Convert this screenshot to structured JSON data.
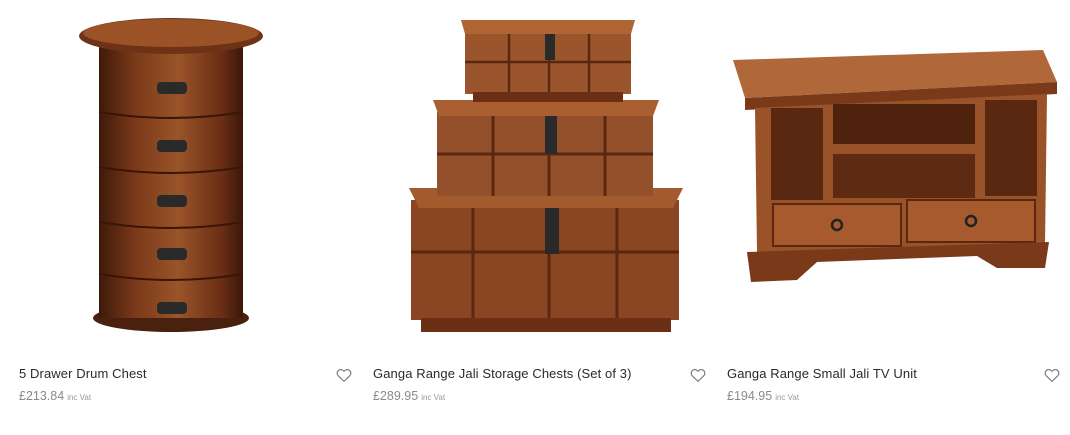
{
  "products": [
    {
      "title": "5 Drawer Drum Chest",
      "price": "£213.84",
      "vat_label": "inc Vat",
      "image_alt": "5 drawer drum chest in sheesham wood",
      "wishlist_icon": "heart-outline-icon"
    },
    {
      "title": "Ganga Range Jali Storage Chests (Set of 3)",
      "price": "£289.95",
      "vat_label": "inc Vat",
      "image_alt": "set of three stacked storage chests",
      "wishlist_icon": "heart-outline-icon"
    },
    {
      "title": "Ganga Range Small Jali TV Unit",
      "price": "£194.95",
      "vat_label": "inc Vat",
      "image_alt": "small wooden tv unit with two drawers",
      "wishlist_icon": "heart-outline-icon"
    }
  ],
  "colors": {
    "wood_dark": "#5a2a12",
    "wood_mid": "#8a4a24",
    "wood_light": "#b5703f",
    "card_bg": "#f4f4f4",
    "price_text": "#8a8a8a"
  }
}
